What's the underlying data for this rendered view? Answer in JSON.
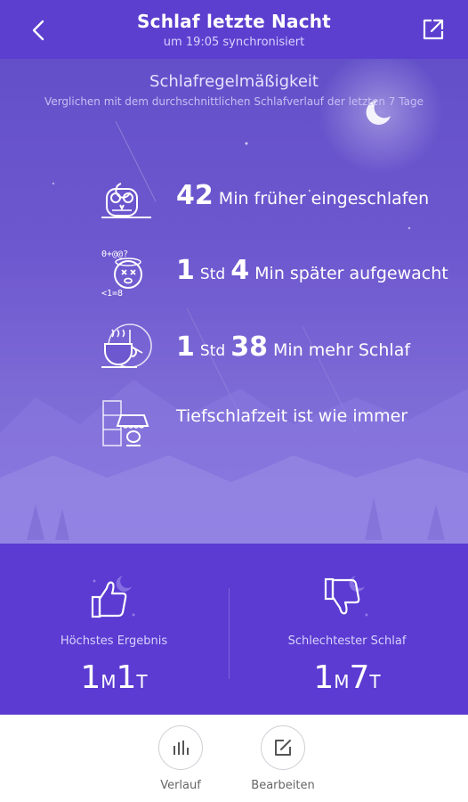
{
  "header": {
    "title": "Schlaf letzte Nacht",
    "subtitle": "um 19:05 synchronisiert"
  },
  "hero": {
    "title": "Schlafregelmäßigkeit",
    "subtitle": "Verglichen mit dem durchschnittlichen Schlafverlauf der letzten 7 Tage",
    "rows": [
      {
        "icon": "owl-icon",
        "num1": "42",
        "unit1": "",
        "num2": "",
        "text": "Min früher eingeschlafen"
      },
      {
        "icon": "dizzy-face-icon",
        "num1": "1",
        "unit1": "Std",
        "num2": "4",
        "text": "Min später aufgewacht"
      },
      {
        "icon": "coffee-cup-icon",
        "num1": "1",
        "unit1": "Std",
        "num2": "38",
        "text": "Min mehr Schlaf"
      },
      {
        "icon": "lamp-icon",
        "num1": "",
        "unit1": "",
        "num2": "",
        "text": "Tiefschlafzeit ist wie immer"
      }
    ]
  },
  "stats": {
    "best": {
      "label": "Höchstes Ergebnis",
      "value1": "1",
      "unit1": "M",
      "value2": "1",
      "unit2": "T",
      "icon": "thumbs-up-icon"
    },
    "worst": {
      "label": "Schlechtester Schlaf",
      "value1": "1",
      "unit1": "M",
      "value2": "7",
      "unit2": "T",
      "icon": "thumbs-down-icon"
    }
  },
  "footer": {
    "history_label": "Verlauf",
    "edit_label": "Bearbeiten"
  },
  "colors": {
    "header": "#5c3fcf",
    "hero": "#6e58cf",
    "stats": "#5b3bd1"
  }
}
